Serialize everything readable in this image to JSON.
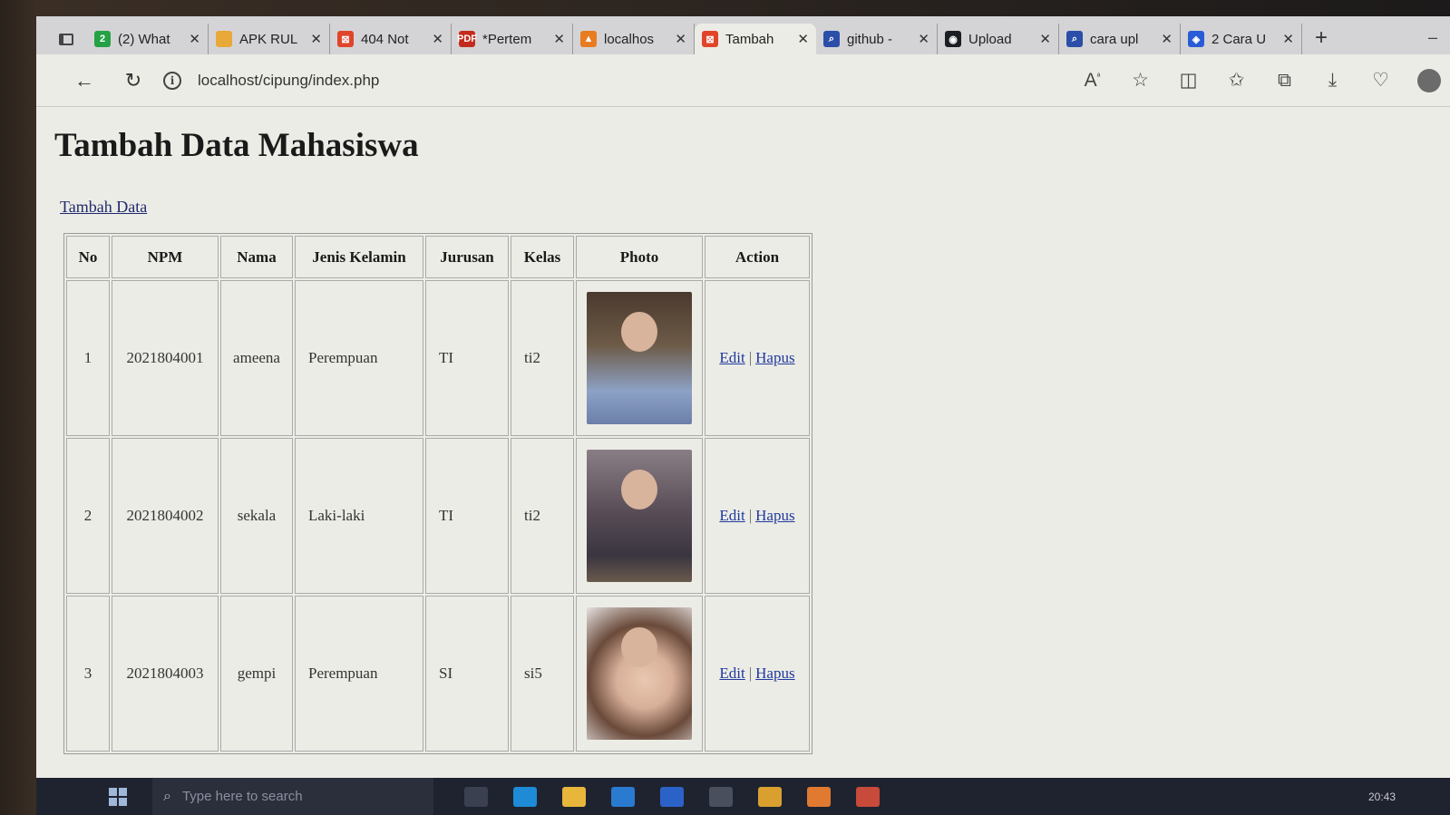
{
  "browser": {
    "tabs": [
      {
        "label": "(2) What",
        "icon": "whatsapp-icon",
        "color": "#25a244",
        "glyph": "2",
        "active": false
      },
      {
        "label": "APK RUL",
        "icon": "google-drive-icon",
        "color": "#e8a83a",
        "glyph": "",
        "active": false
      },
      {
        "label": "404 Not",
        "icon": "xampp-icon",
        "color": "#e0452a",
        "glyph": "⊠",
        "active": false
      },
      {
        "label": "*Pertem",
        "icon": "pdf-icon",
        "color": "#c42b1c",
        "glyph": "PDF",
        "active": false
      },
      {
        "label": "localhos",
        "icon": "phpmyadmin-icon",
        "color": "#e87c20",
        "glyph": "▲",
        "active": false
      },
      {
        "label": "Tambah",
        "icon": "xampp-icon",
        "color": "#e0452a",
        "glyph": "⊠",
        "active": true
      },
      {
        "label": "github -",
        "icon": "search-icon",
        "color": "#2b4fa8",
        "glyph": "⌕",
        "active": false
      },
      {
        "label": "Upload",
        "icon": "github-icon",
        "color": "#1b1f23",
        "glyph": "◉",
        "active": false
      },
      {
        "label": "cara upl",
        "icon": "search-icon",
        "color": "#2b4fa8",
        "glyph": "⌕",
        "active": false
      },
      {
        "label": "2 Cara U",
        "icon": "site-icon",
        "color": "#2a5bd7",
        "glyph": "◈",
        "active": false
      }
    ],
    "new_tab_glyph": "+",
    "url": "localhost/cipung/index.php",
    "info_glyph": "i"
  },
  "page": {
    "title": "Tambah Data Mahasiswa",
    "add_link": "Tambah Data",
    "table": {
      "headers": [
        "No",
        "NPM",
        "Nama",
        "Jenis Kelamin",
        "Jurusan",
        "Kelas",
        "Photo",
        "Action"
      ],
      "rows": [
        {
          "no": "1",
          "npm": "2021804001",
          "nama": "ameena",
          "jk": "Perempuan",
          "jurusan": "TI",
          "kelas": "ti2",
          "photo": "p1"
        },
        {
          "no": "2",
          "npm": "2021804002",
          "nama": "sekala",
          "jk": "Laki-laki",
          "jurusan": "TI",
          "kelas": "ti2",
          "photo": "p2"
        },
        {
          "no": "3",
          "npm": "2021804003",
          "nama": "gempi",
          "jk": "Perempuan",
          "jurusan": "SI",
          "kelas": "si5",
          "photo": "p3"
        }
      ],
      "edit_label": "Edit",
      "delete_label": "Hapus",
      "separator": "|"
    }
  },
  "taskbar": {
    "search_placeholder": "Type here to search",
    "clock": "20:43"
  }
}
